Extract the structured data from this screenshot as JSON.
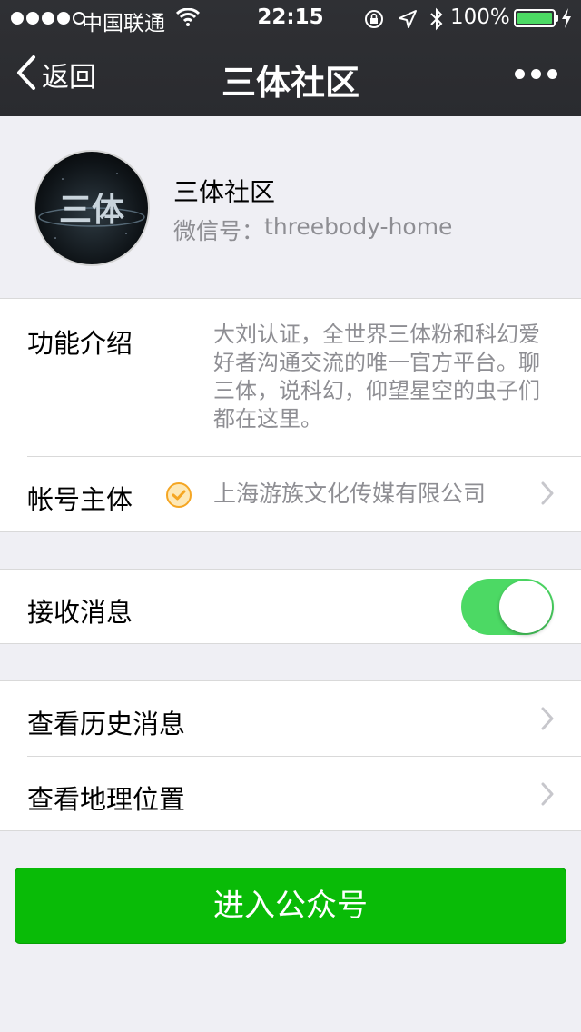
{
  "status_bar": {
    "carrier": "中国联通",
    "time": "22:15",
    "battery_percent": "100%",
    "signal_strength": "4 of 5"
  },
  "nav": {
    "back_label": "返回",
    "title": "三体社区"
  },
  "profile": {
    "name": "三体社区",
    "wechat_id_label": "微信号：",
    "wechat_id": "threebody-home",
    "avatar_text": "三体"
  },
  "info": {
    "intro_label": "功能介绍",
    "intro_text": "大刘认证，全世界三体粉和科幻爱好者沟通交流的唯一官方平台。聊三体，说科幻，仰望星空的虫子们都在这里。",
    "account_label": "帐号主体",
    "account_value": "上海游族文化传媒有限公司"
  },
  "settings": {
    "receive_label": "接收消息",
    "receive_enabled": true
  },
  "links": {
    "history_label": "查看历史消息",
    "location_label": "查看地理位置"
  },
  "actions": {
    "enter_label": "进入公众号"
  },
  "colors": {
    "nav_bg": "#2f3034",
    "page_bg": "#efeff4",
    "accent_green": "#09bb07",
    "toggle_green": "#4cd964",
    "secondary_text": "#8e8e93",
    "verify_orange": "#f5a623"
  }
}
